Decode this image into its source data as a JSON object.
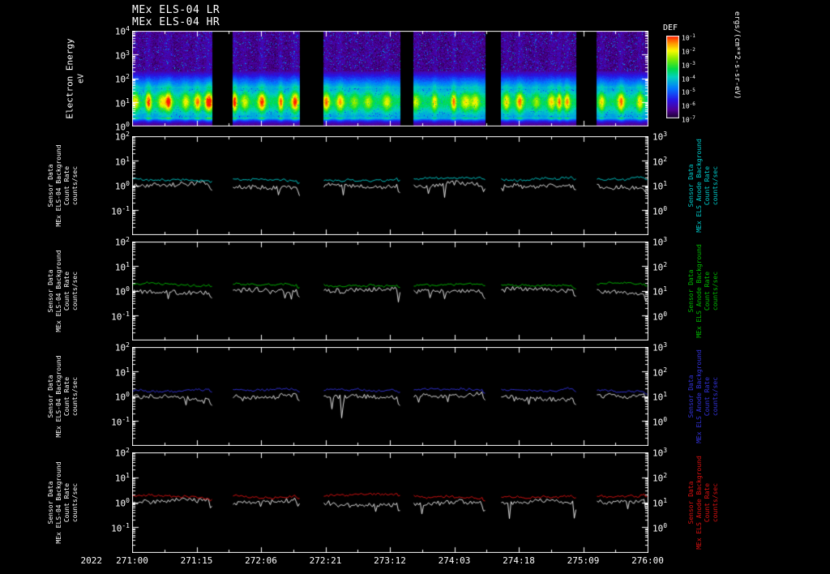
{
  "header": {
    "title_line1": "MEx ELS-04 LR",
    "title_line2": "MEx ELS-04 HR"
  },
  "colors": {
    "background": "#000000",
    "axis": "#ffffff",
    "trace_primary": "#ffffff"
  },
  "spectrogram": {
    "ylabel": "Electron Energy",
    "ylabel_units": "eV",
    "ytick_exps": [
      4,
      3,
      2,
      1,
      0
    ],
    "colorbar_label": "DEF",
    "colorbar_units": "ergs/(cm**2-s-sr-eV)",
    "colorbar_tick_exps": [
      -1,
      -2,
      -3,
      -4,
      -5,
      -6,
      -7
    ]
  },
  "panels": [
    {
      "name": "background-panel-cyan",
      "color": "#00cccc",
      "left_label_lines": [
        "Sensor Data",
        "MEx ELS-04 Background",
        "Count Rate",
        "counts/sec"
      ],
      "right_label_lines": [
        "Sensor Data",
        "MEx ELS Anode Background",
        "Count Rate",
        "counts/sec"
      ],
      "left_tick_exps": [
        2,
        1,
        0,
        -1
      ],
      "right_tick_exps": [
        3,
        2,
        1,
        0
      ]
    },
    {
      "name": "background-panel-green",
      "color": "#00bb00",
      "left_label_lines": [
        "Sensor Data",
        "MEx ELS-04 Background",
        "Count Rate",
        "counts/sec"
      ],
      "right_label_lines": [
        "Sensor Data",
        "MEx ELS Anode Background",
        "Count Rate",
        "counts/sec"
      ],
      "left_tick_exps": [
        2,
        1,
        0,
        -1
      ],
      "right_tick_exps": [
        3,
        2,
        1,
        0
      ]
    },
    {
      "name": "background-panel-blue",
      "color": "#3333dd",
      "left_label_lines": [
        "Sensor Data",
        "MEx ELS-04 Background",
        "Count Rate",
        "counts/sec"
      ],
      "right_label_lines": [
        "Sensor Data",
        "MEx ELS Anode Background",
        "Count Rate",
        "counts/sec"
      ],
      "left_tick_exps": [
        2,
        1,
        0,
        -1
      ],
      "right_tick_exps": [
        3,
        2,
        1,
        0
      ]
    },
    {
      "name": "background-panel-red",
      "color": "#dd1111",
      "left_label_lines": [
        "Sensor Data",
        "MEx ELS-04 Background",
        "Count Rate",
        "counts/sec"
      ],
      "right_label_lines": [
        "Sensor Data",
        "MEx ELS Anode Background",
        "Count Rate",
        "counts/sec"
      ],
      "left_tick_exps": [
        2,
        1,
        0,
        -1
      ],
      "right_tick_exps": [
        3,
        2,
        1,
        0
      ]
    }
  ],
  "xaxis": {
    "year": "2022",
    "tick_labels": [
      "271:00",
      "271:15",
      "272:06",
      "272:21",
      "273:12",
      "274:03",
      "274:18",
      "275:09",
      "276:00"
    ]
  },
  "chart_data": [
    {
      "type": "heatmap",
      "title": "MEx ELS-04 LR / MEx ELS-04 HR electron energy-time spectrogram",
      "xlabel": "2022 day-of-year:hour",
      "ylabel": "Electron Energy eV",
      "x_ticks": [
        "271:00",
        "271:15",
        "272:06",
        "272:21",
        "273:12",
        "274:03",
        "274:18",
        "275:09",
        "276:00"
      ],
      "y_scale": "log",
      "y_range": [
        1,
        10000
      ],
      "z_label": "DEF",
      "z_units": "ergs/(cm**2-s-sr-eV)",
      "z_scale": "log",
      "z_range_exps": [
        -7,
        -1
      ],
      "colorbar_position": "right",
      "grid": false,
      "segments_x_fraction": [
        [
          0.0,
          0.155
        ],
        [
          0.195,
          0.325
        ],
        [
          0.37,
          0.52
        ],
        [
          0.545,
          0.685
        ],
        [
          0.715,
          0.86
        ],
        [
          0.9,
          1.0
        ]
      ],
      "features": "Bright green band between about 5 and 100 eV with quasi-periodic vertical flux enhancements, strongest (orange-red) in the first two orbit segments; sparse purple-blue noise above 100 eV; black vertical stripes are data gaps between orbit passes."
    },
    {
      "type": "line",
      "panel": 1,
      "ylabel_left": "Sensor Data MEx ELS-04 Background Count Rate counts/sec",
      "y_scale": "log",
      "y_ticks_left_exps": [
        2,
        1,
        0,
        -1
      ],
      "y_ticks_right_exps": [
        3,
        2,
        1,
        0
      ],
      "series": [
        {
          "name": "background count rate",
          "color": "#00cccc",
          "approx_level_counts_per_sec": 1.6
        },
        {
          "name": "count rate",
          "color": "#ffffff",
          "approx_level_counts_per_sec": 1.0
        }
      ],
      "note": "noisy flat traces near 1-2 counts/sec, gaps matching spectrogram segments, downward spikes at segment ends"
    },
    {
      "type": "line",
      "panel": 2,
      "ylabel_left": "Sensor Data MEx ELS-04 Background Count Rate counts/sec",
      "y_scale": "log",
      "y_ticks_left_exps": [
        2,
        1,
        0,
        -1
      ],
      "y_ticks_right_exps": [
        3,
        2,
        1,
        0
      ],
      "series": [
        {
          "name": "background count rate",
          "color": "#00bb00",
          "approx_level_counts_per_sec": 1.6
        },
        {
          "name": "count rate",
          "color": "#ffffff",
          "approx_level_counts_per_sec": 1.0
        }
      ],
      "note": "noisy flat traces near 1-2 counts/sec, gaps matching spectrogram segments"
    },
    {
      "type": "line",
      "panel": 3,
      "ylabel_left": "Sensor Data MEx ELS-04 Background Count Rate counts/sec",
      "y_scale": "log",
      "y_ticks_left_exps": [
        2,
        1,
        0,
        -1
      ],
      "y_ticks_right_exps": [
        3,
        2,
        1,
        0
      ],
      "series": [
        {
          "name": "background count rate",
          "color": "#3333dd",
          "approx_level_counts_per_sec": 1.6
        },
        {
          "name": "count rate",
          "color": "#ffffff",
          "approx_level_counts_per_sec": 1.0
        }
      ],
      "note": "noisy flat traces near 1-2 counts/sec, gaps matching spectrogram segments"
    },
    {
      "type": "line",
      "panel": 4,
      "ylabel_left": "Sensor Data MEx ELS-04 Background Count Rate counts/sec",
      "y_scale": "log",
      "y_ticks_left_exps": [
        2,
        1,
        0,
        -1
      ],
      "y_ticks_right_exps": [
        3,
        2,
        1,
        0
      ],
      "series": [
        {
          "name": "background count rate",
          "color": "#dd1111",
          "approx_level_counts_per_sec": 1.6
        },
        {
          "name": "count rate",
          "color": "#ffffff",
          "approx_level_counts_per_sec": 1.0
        }
      ],
      "note": "noisy flat traces near 1-2 counts/sec, gaps matching spectrogram segments"
    }
  ]
}
